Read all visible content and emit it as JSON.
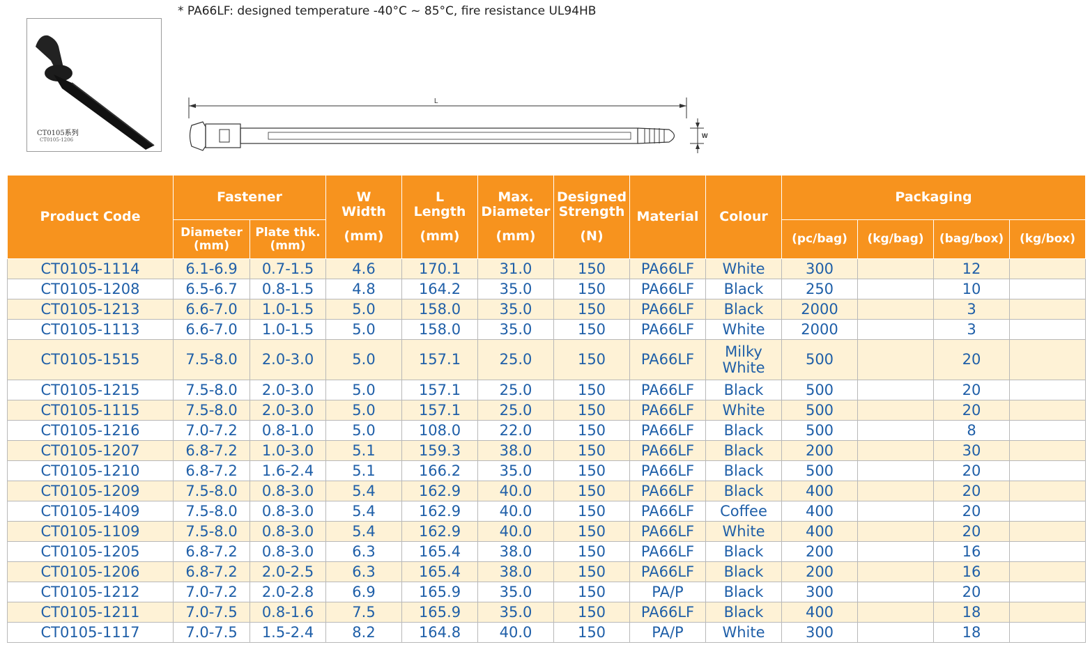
{
  "note": "* PA66LF: designed temperature -40°C ~ 85°C, fire resistance UL94HB",
  "photo": {
    "caption_series": "CT0105系列",
    "caption_code": "CT0105-1206"
  },
  "drawing": {
    "label_length": "L",
    "label_width": "W"
  },
  "table": {
    "headers": {
      "product_code": "Product Code",
      "fastener": "Fastener",
      "diameter": "Diameter",
      "diameter_unit": "(mm)",
      "plate": "Plate thk.",
      "plate_unit": "(mm)",
      "w1": "W",
      "w2": "Width",
      "w_unit": "(mm)",
      "l1": "L",
      "l2": "Length",
      "l_unit": "(mm)",
      "max1": "Max.",
      "max2": "Diameter",
      "max_unit": "(mm)",
      "ds1": "Designed",
      "ds2": "Strength",
      "ds_unit": "(N)",
      "material": "Material",
      "colour": "Colour",
      "packaging": "Packaging",
      "pc_bag": "(pc/bag)",
      "kg_bag": "(kg/bag)",
      "bag_box": "(bag/box)",
      "kg_box": "(kg/box)"
    },
    "rows": [
      [
        "CT0105-1114",
        "6.1-6.9",
        "0.7-1.5",
        "4.6",
        "170.1",
        "31.0",
        "150",
        "PA66LF",
        "White",
        "300",
        "",
        "12",
        ""
      ],
      [
        "CT0105-1208",
        "6.5-6.7",
        "0.8-1.5",
        "4.8",
        "164.2",
        "35.0",
        "150",
        "PA66LF",
        "Black",
        "250",
        "",
        "10",
        ""
      ],
      [
        "CT0105-1213",
        "6.6-7.0",
        "1.0-1.5",
        "5.0",
        "158.0",
        "35.0",
        "150",
        "PA66LF",
        "Black",
        "2000",
        "",
        "3",
        ""
      ],
      [
        "CT0105-1113",
        "6.6-7.0",
        "1.0-1.5",
        "5.0",
        "158.0",
        "35.0",
        "150",
        "PA66LF",
        "White",
        "2000",
        "",
        "3",
        ""
      ],
      [
        "CT0105-1515",
        "7.5-8.0",
        "2.0-3.0",
        "5.0",
        "157.1",
        "25.0",
        "150",
        "PA66LF",
        "Milky White",
        "500",
        "",
        "20",
        ""
      ],
      [
        "CT0105-1215",
        "7.5-8.0",
        "2.0-3.0",
        "5.0",
        "157.1",
        "25.0",
        "150",
        "PA66LF",
        "Black",
        "500",
        "",
        "20",
        ""
      ],
      [
        "CT0105-1115",
        "7.5-8.0",
        "2.0-3.0",
        "5.0",
        "157.1",
        "25.0",
        "150",
        "PA66LF",
        "White",
        "500",
        "",
        "20",
        ""
      ],
      [
        "CT0105-1216",
        "7.0-7.2",
        "0.8-1.0",
        "5.0",
        "108.0",
        "22.0",
        "150",
        "PA66LF",
        "Black",
        "500",
        "",
        "8",
        ""
      ],
      [
        "CT0105-1207",
        "6.8-7.2",
        "1.0-3.0",
        "5.1",
        "159.3",
        "38.0",
        "150",
        "PA66LF",
        "Black",
        "200",
        "",
        "30",
        ""
      ],
      [
        "CT0105-1210",
        "6.8-7.2",
        "1.6-2.4",
        "5.1",
        "166.2",
        "35.0",
        "150",
        "PA66LF",
        "Black",
        "500",
        "",
        "20",
        ""
      ],
      [
        "CT0105-1209",
        "7.5-8.0",
        "0.8-3.0",
        "5.4",
        "162.9",
        "40.0",
        "150",
        "PA66LF",
        "Black",
        "400",
        "",
        "20",
        ""
      ],
      [
        "CT0105-1409",
        "7.5-8.0",
        "0.8-3.0",
        "5.4",
        "162.9",
        "40.0",
        "150",
        "PA66LF",
        "Coffee",
        "400",
        "",
        "20",
        ""
      ],
      [
        "CT0105-1109",
        "7.5-8.0",
        "0.8-3.0",
        "5.4",
        "162.9",
        "40.0",
        "150",
        "PA66LF",
        "White",
        "400",
        "",
        "20",
        ""
      ],
      [
        "CT0105-1205",
        "6.8-7.2",
        "0.8-3.0",
        "6.3",
        "165.4",
        "38.0",
        "150",
        "PA66LF",
        "Black",
        "200",
        "",
        "16",
        ""
      ],
      [
        "CT0105-1206",
        "6.8-7.2",
        "2.0-2.5",
        "6.3",
        "165.4",
        "38.0",
        "150",
        "PA66LF",
        "Black",
        "200",
        "",
        "16",
        ""
      ],
      [
        "CT0105-1212",
        "7.0-7.2",
        "2.0-2.8",
        "6.9",
        "165.9",
        "35.0",
        "150",
        "PA/P",
        "Black",
        "300",
        "",
        "20",
        ""
      ],
      [
        "CT0105-1211",
        "7.0-7.5",
        "0.8-1.6",
        "7.5",
        "165.9",
        "35.0",
        "150",
        "PA66LF",
        "Black",
        "400",
        "",
        "18",
        ""
      ],
      [
        "CT0105-1117",
        "7.0-7.5",
        "1.5-2.4",
        "8.2",
        "164.8",
        "40.0",
        "150",
        "PA/P",
        "White",
        "300",
        "",
        "18",
        ""
      ]
    ]
  },
  "colors": {
    "header_bg": "#f7931e",
    "header_text": "#ffffff",
    "cell_text": "#1f5fa8",
    "row_alt": "#fef2d6"
  }
}
